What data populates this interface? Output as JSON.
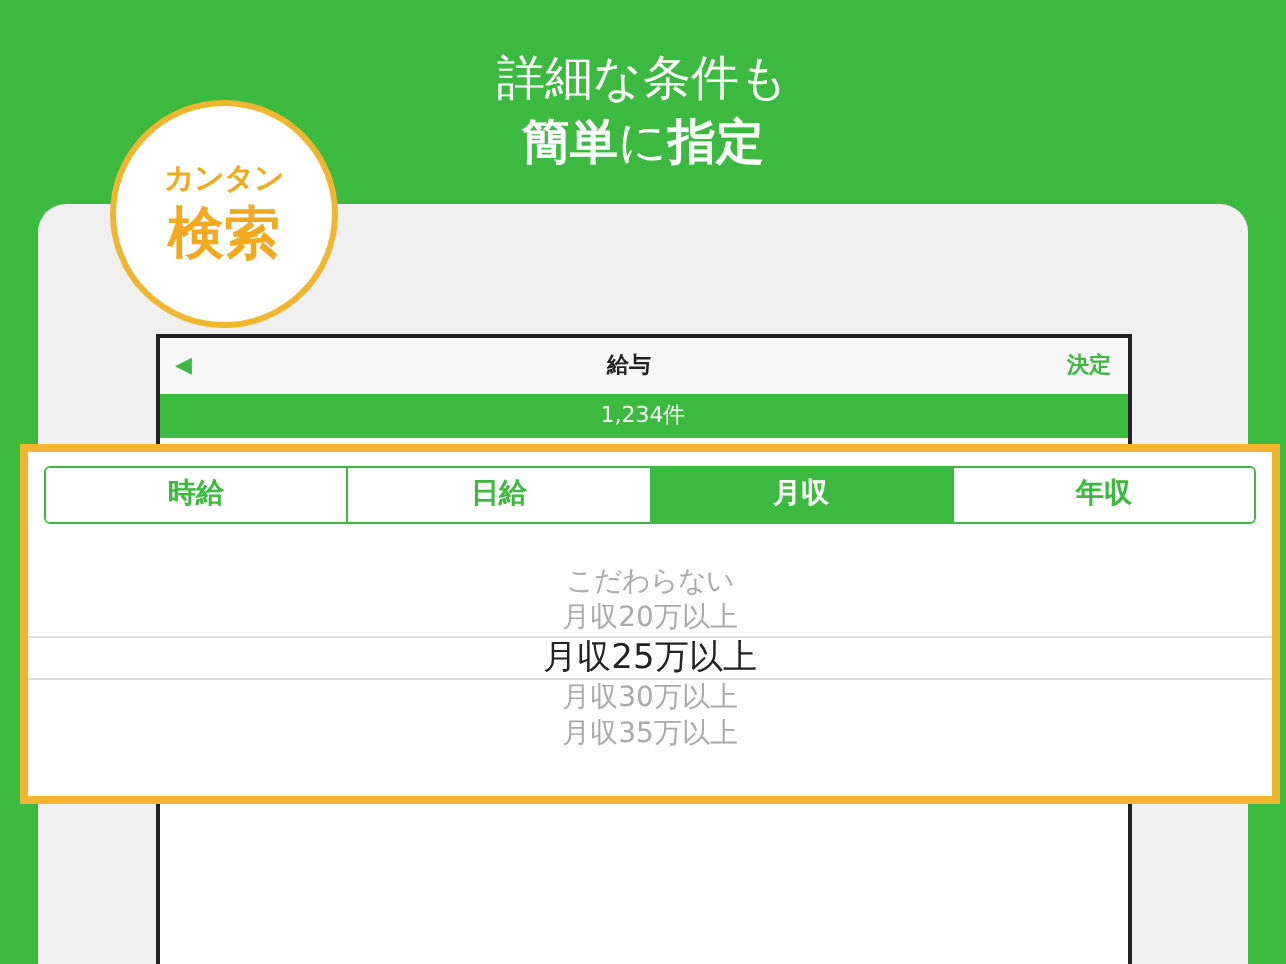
{
  "headline": {
    "line_1": "詳細な条件も",
    "line_2": "**簡単**に**指定**"
  },
  "badge": {
    "top": "カンタン",
    "bottom": "検索"
  },
  "nav_bar": {
    "back": "◀",
    "title": "給与",
    "action": "決定"
  },
  "result_count": "1,234件",
  "tabs": [
    {
      "label": "時給",
      "selected": false
    },
    {
      "label": "日給",
      "selected": false
    },
    {
      "label": "月収",
      "selected": true
    },
    {
      "label": "年収",
      "selected": false
    }
  ],
  "picker": [
    {
      "label": "こだわらない",
      "selected": false
    },
    {
      "label": "月収20万以上",
      "selected": false
    },
    {
      "label": "月収25万以上",
      "selected": true
    },
    {
      "label": "月収30万以上",
      "selected": false
    },
    {
      "label": "月収35万以上",
      "selected": false
    }
  ]
}
